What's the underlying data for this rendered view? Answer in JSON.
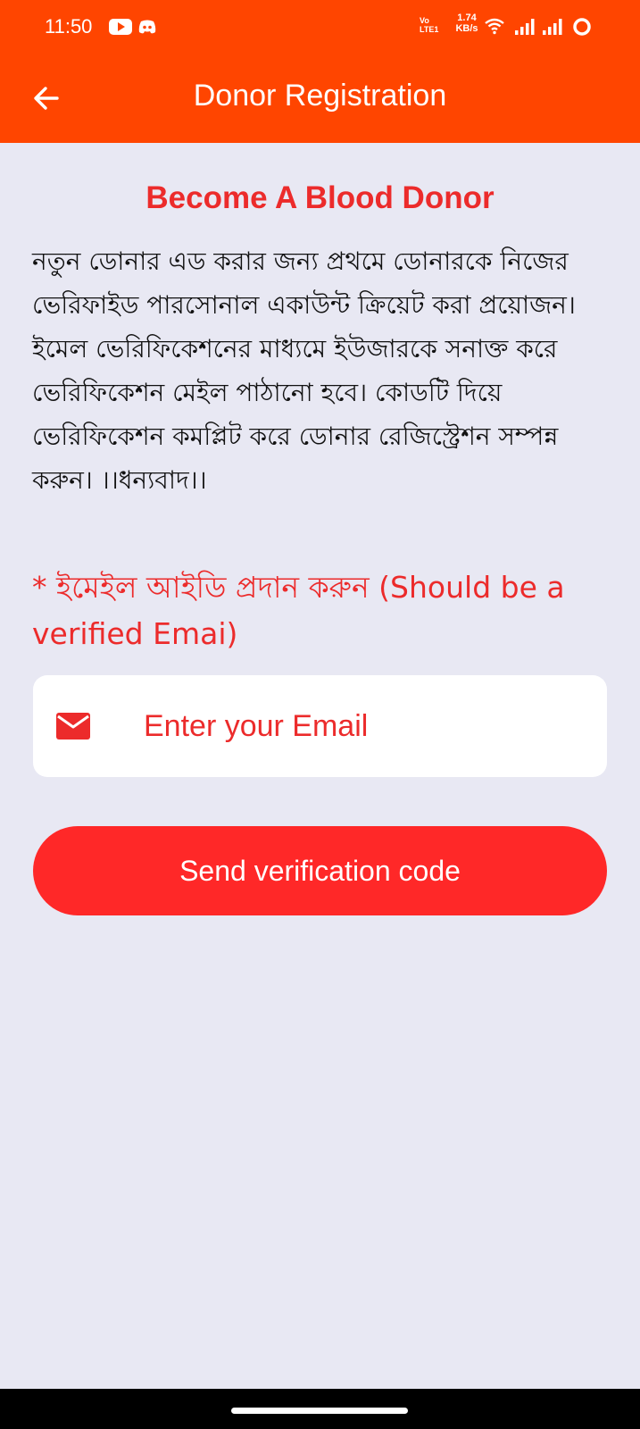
{
  "status_bar": {
    "time": "11:50",
    "volte": "Vo\nLTE1",
    "net_speed_value": "1.74",
    "net_speed_unit": "KB/s"
  },
  "app_bar": {
    "title": "Donor Registration"
  },
  "content": {
    "heading": "Become A Blood Donor",
    "intro": "নতুন ডোনার এড করার জন্য প্রথমে ডোনারকে নিজের ভেরিফাইড পারসোনাল একাউন্ট ক্রিয়েট করা প্রয়োজন। ইমেল ভেরিফিকেশনের মাধ্যমে ইউজারকে সনাক্ত করে ভেরিফিকেশন মেইল পাঠানো হবে। কোডটি দিয়ে ভেরিফিকেশন কমপ্লিট করে ডোনার রেজিস্ট্রেশন সম্পন্ন করুন। ।।ধন্যবাদ।।",
    "email_label": "* ইমেইল আইডি প্রদান করুন (Should be a verified Emai)",
    "email_input": {
      "placeholder": "Enter your Email",
      "value": ""
    },
    "send_button_label": "Send verification code"
  },
  "colors": {
    "app_bar": "#ff4500",
    "accent_red": "#ec2b2b",
    "button": "#ff2828",
    "background": "#e8e8f3"
  },
  "icons": [
    "back-arrow-icon",
    "mail-icon",
    "youtube-icon",
    "discord-icon",
    "wifi-icon",
    "signal-icon",
    "battery-icon"
  ]
}
